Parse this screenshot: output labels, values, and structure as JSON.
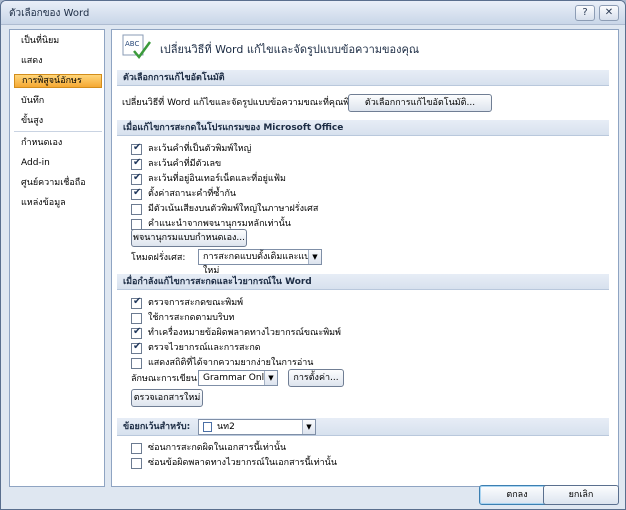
{
  "window": {
    "title": "ตัวเลือกของ Word",
    "help_icon": "?",
    "close_icon": "✕"
  },
  "sidebar": {
    "items": [
      {
        "label": "เป็นที่นิยม"
      },
      {
        "label": "แสดง"
      },
      {
        "label": "การพิสูจน์อักษร",
        "active": true
      },
      {
        "label": "บันทึก"
      },
      {
        "label": "ขั้นสูง"
      },
      {
        "label": "กำหนดเอง"
      },
      {
        "label": "Add-in"
      },
      {
        "label": "ศูนย์ความเชื่อถือ"
      },
      {
        "label": "แหล่งข้อมูล"
      }
    ]
  },
  "banner": {
    "icon": "abc-check-icon",
    "icon_text": "ABC",
    "text": "เปลี่ยนวิธีที่ Word แก้ไขและจัดรูปแบบข้อความของคุณ"
  },
  "autocorrect": {
    "header": "ตัวเลือกการแก้ไขอัตโนมัติ",
    "label": "เปลี่ยนวิธีที่ Word แก้ไขและจัดรูปแบบข้อความขณะที่คุณพิมพ์:",
    "button": "ตัวเลือกการแก้ไขอัตโนมัติ..."
  },
  "office": {
    "header": "เมื่อแก้ไขการสะกดในโปรแกรมของ Microsoft Office",
    "checks": [
      {
        "label": "ละเว้นคำที่เป็นตัวพิมพ์ใหญ่",
        "checked": true
      },
      {
        "label": "ละเว้นคำที่มีตัวเลข",
        "checked": true
      },
      {
        "label": "ละเว้นที่อยู่อินเทอร์เน็ตและที่อยู่แฟ้ม",
        "checked": true
      },
      {
        "label": "ตั้งค่าสถานะคำที่ซ้ำกัน",
        "checked": true
      },
      {
        "label": "มีตัวเน้นเสียงบนตัวพิมพ์ใหญ่ในภาษาฝรั่งเศส",
        "checked": false
      },
      {
        "label": "คำแนะนำจากพจนานุกรมหลักเท่านั้น",
        "checked": false
      }
    ],
    "dict_button": "พจนานุกรมแบบกำหนดเอง...",
    "french_label": "โหมดฝรั่งเศส:",
    "french_value": "การสะกดแบบดั้งเดิมและแบบใหม่"
  },
  "word": {
    "header": "เมื่อกำลังแก้ไขการสะกดและไวยากรณ์ใน Word",
    "checks": [
      {
        "label": "ตรวจการสะกดขณะพิมพ์",
        "checked": true
      },
      {
        "label": "ใช้การสะกดตามบริบท",
        "checked": false
      },
      {
        "label": "ทำเครื่องหมายข้อผิดพลาดทางไวยากรณ์ขณะพิมพ์",
        "checked": true
      },
      {
        "label": "ตรวจไวยากรณ์และการสะกด",
        "checked": true
      },
      {
        "label": "แสดงสถิติที่ได้จากความยากง่ายในการอ่าน",
        "checked": false
      }
    ],
    "style_label": "ลักษณะการเขียน:",
    "style_value": "Grammar Only",
    "settings_button": "การตั้งค่า...",
    "recheck_button": "ตรวจเอกสารใหม่"
  },
  "exceptions": {
    "label": "ข้อยกเว้นสำหรับ:",
    "doc_value": "นท2",
    "checks": [
      {
        "label": "ซ่อนการสะกดผิดในเอกสารนี้เท่านั้น",
        "checked": false
      },
      {
        "label": "ซ่อนข้อผิดพลาดทางไวยากรณ์ในเอกสารนี้เท่านั้น",
        "checked": false
      }
    ]
  },
  "footer": {
    "ok": "ตกลง",
    "cancel": "ยกเลิก"
  }
}
